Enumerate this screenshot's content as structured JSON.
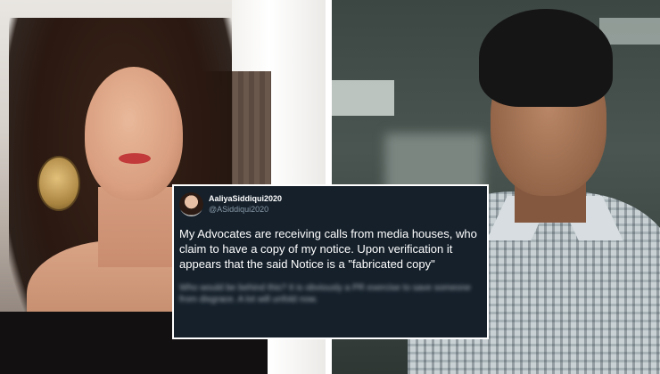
{
  "tweet": {
    "display_name": "AaliyaSiddiqui2020",
    "handle": "@ASiddiqui2020",
    "text": "My Advocates are receiving calls from media houses, who claim to have a copy of my notice. Upon verification it appears that the said Notice is a \"fabricated copy\"",
    "blurred_text": "Who would be behind this? It is obviously a PR exercise to save someone from disgrace. A lot will unfold now."
  },
  "colors": {
    "tweet_bg": "#15202b",
    "text": "#ffffff",
    "handle": "#8899a6"
  }
}
